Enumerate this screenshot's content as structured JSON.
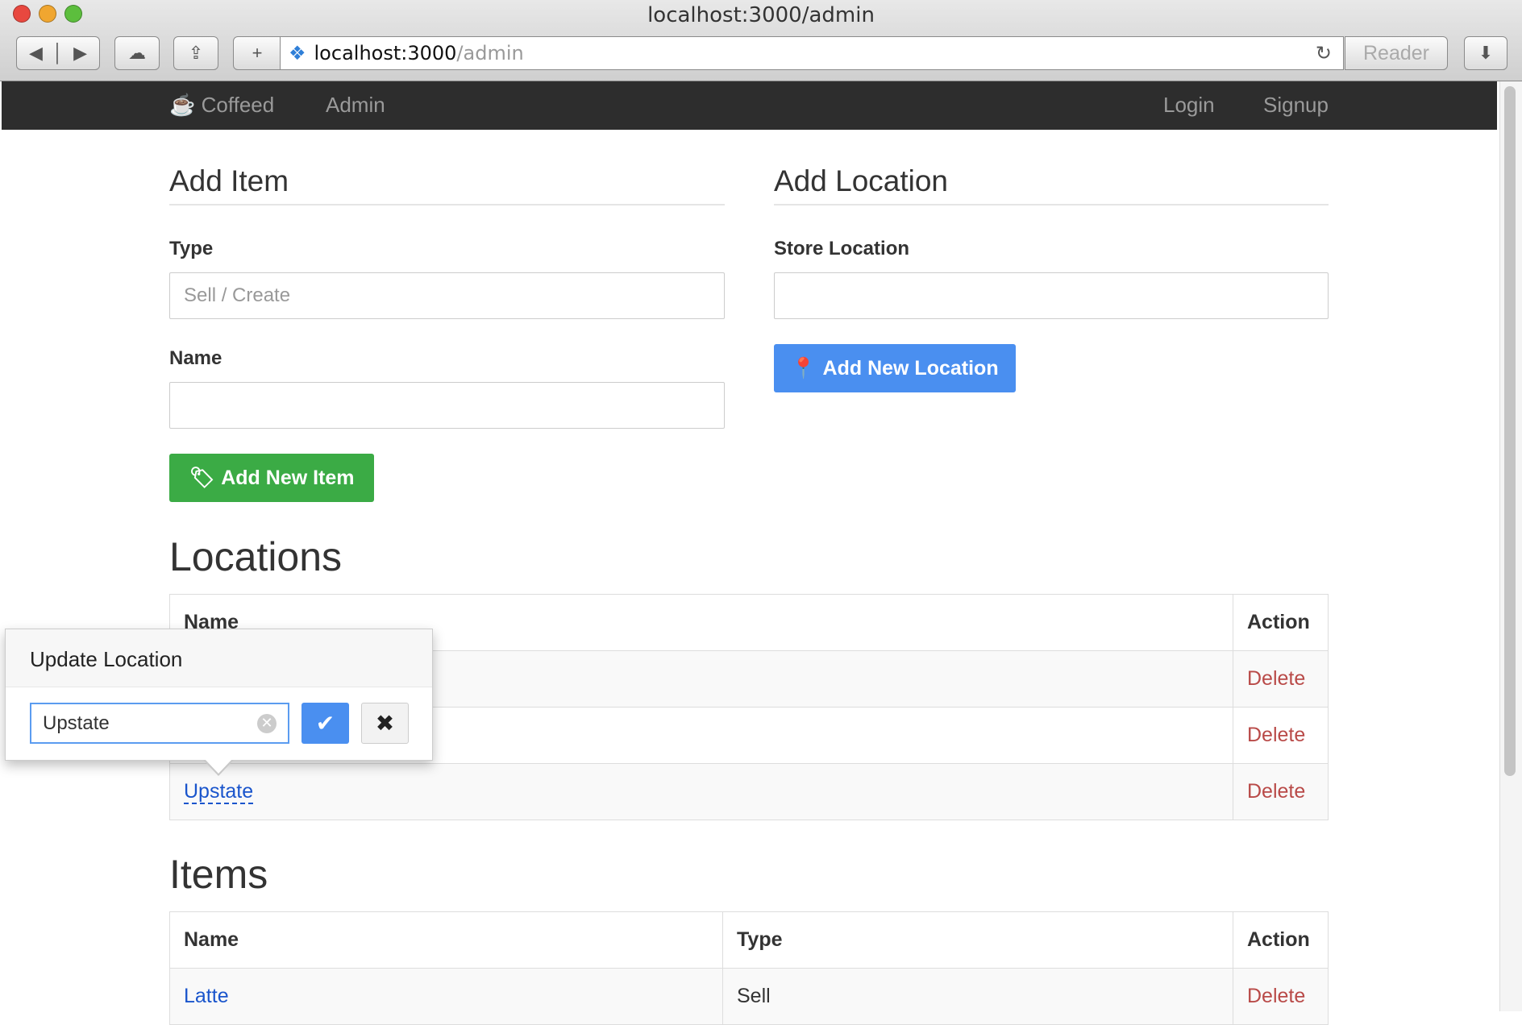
{
  "browser": {
    "window_title": "localhost:3000/admin",
    "url_host": "localhost:3000",
    "url_path": "/admin",
    "reader_label": "Reader"
  },
  "navbar": {
    "brand": "Coffeed",
    "links": [
      "Admin"
    ],
    "right_links": [
      "Login",
      "Signup"
    ]
  },
  "add_item": {
    "title": "Add Item",
    "type_label": "Type",
    "type_placeholder": "Sell / Create",
    "type_value": "",
    "name_label": "Name",
    "name_value": "",
    "button": "Add New Item",
    "button_color": "#3bab45"
  },
  "add_location": {
    "title": "Add Location",
    "store_label": "Store Location",
    "store_value": "",
    "button": "Add New Location",
    "button_color": "#4a8ff0"
  },
  "locations": {
    "title": "Locations",
    "columns": [
      "Name",
      "Action"
    ],
    "rows": [
      {
        "name": "",
        "action": "Delete"
      },
      {
        "name": "",
        "action": "Delete"
      },
      {
        "name": "Upstate",
        "action": "Delete"
      }
    ]
  },
  "items": {
    "title": "Items",
    "columns": [
      "Name",
      "Type",
      "Action"
    ],
    "rows": [
      {
        "name": "Latte",
        "type": "Sell",
        "action": "Delete"
      }
    ]
  },
  "popover": {
    "title": "Update Location",
    "value": "Upstate"
  }
}
